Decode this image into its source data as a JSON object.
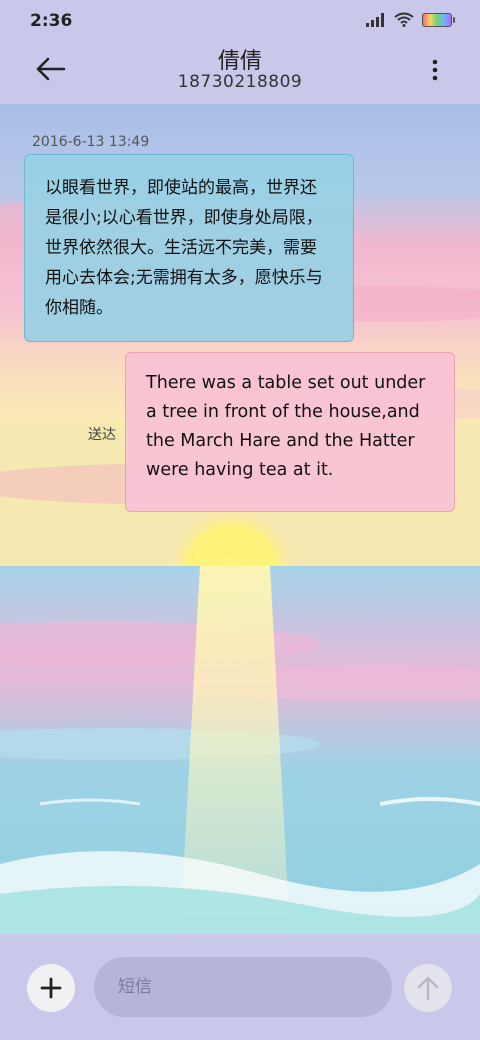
{
  "status_bar": {
    "time": "2:36"
  },
  "header": {
    "contact_name": "倩倩",
    "phone_number": "18730218809"
  },
  "conversation": {
    "timestamp": "2016-6-13 13:49",
    "incoming_message": "以眼看世界，即使站的最高，世界还是很小;以心看世界，即使身处局限，世界依然很大。生活远不完美，需要用心去体会;无需拥有太多，愿快乐与你相随。",
    "outgoing_message": "There was a table set out under a tree in front of the house,and the March Hare and the Hatter were having tea at it.",
    "outgoing_status": "送达"
  },
  "composer": {
    "placeholder": "短信"
  },
  "icons": {
    "back": "arrow-left-icon",
    "more": "more-vertical-icon",
    "add": "plus-icon",
    "send": "arrow-up-icon",
    "signal": "signal-icon",
    "wifi": "wifi-icon",
    "battery": "battery-icon"
  }
}
